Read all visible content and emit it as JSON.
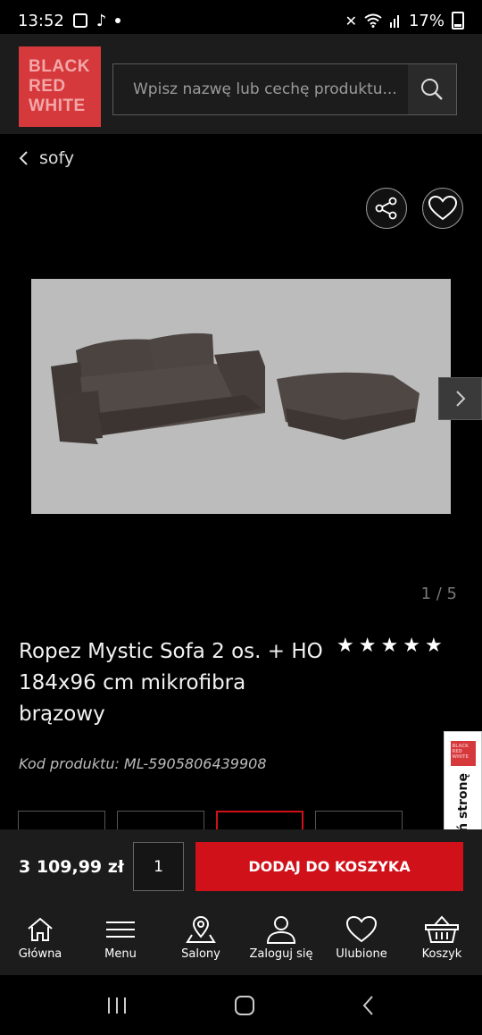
{
  "status_bar": {
    "time": "13:52",
    "battery": "17%"
  },
  "header": {
    "logo_lines": [
      "BLACK",
      "RED",
      "WHITE"
    ],
    "search_placeholder": "Wpisz nazwę lub cechę produktu..."
  },
  "breadcrumb": {
    "label": "sofy"
  },
  "gallery": {
    "current": "1",
    "total": "5",
    "pager_text": "1 / 5"
  },
  "product": {
    "title": "Ropez Mystic Sofa 2 os. + HO 184x96 cm mikrofibra brązowy",
    "rating_stars": 5,
    "code_text": "Kod produktu: ML-5905806439908",
    "price": "3 109,99 zł",
    "quantity": "1",
    "add_to_cart_label": "DODAJ DO KOSZYKA",
    "image_bg": "#bcbcbc"
  },
  "rate_tab": {
    "label": "Oceń stronę",
    "logo_lines": [
      "BLACK",
      "RED",
      "WHITE"
    ]
  },
  "bottom_nav": {
    "items": [
      {
        "label": "Główna",
        "icon": "home-icon"
      },
      {
        "label": "Menu",
        "icon": "menu-icon"
      },
      {
        "label": "Salony",
        "icon": "location-icon"
      },
      {
        "label": "Zaloguj się",
        "icon": "user-icon"
      },
      {
        "label": "Ulubione",
        "icon": "heart-icon"
      },
      {
        "label": "Koszyk",
        "icon": "basket-icon"
      }
    ]
  },
  "colors": {
    "brand_red": "#d6393c",
    "cta_red": "#d0111a",
    "header_bg": "#1c1c1c"
  }
}
